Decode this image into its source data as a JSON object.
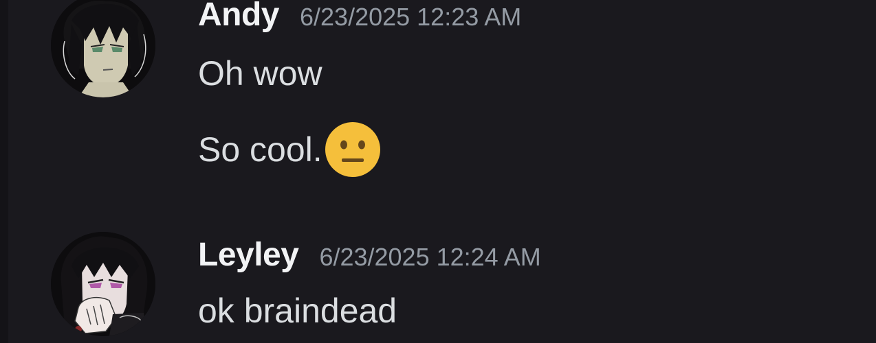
{
  "messages": [
    {
      "username": "Andy",
      "timestamp": "6/23/2025 12:23 AM",
      "avatar_icon": "andy-avatar",
      "lines": [
        "Oh wow",
        "So cool."
      ],
      "emoji": "neutral-face"
    },
    {
      "username": "Leyley",
      "timestamp": "6/23/2025 12:24 AM",
      "avatar_icon": "leyley-avatar",
      "lines": [
        "ok braindead"
      ]
    }
  ],
  "colors": {
    "background": "#1a191e",
    "username": "#f2f3f5",
    "timestamp": "#949ba4",
    "message_text": "#dbdee1",
    "emoji_fill": "#f5bf3b"
  }
}
